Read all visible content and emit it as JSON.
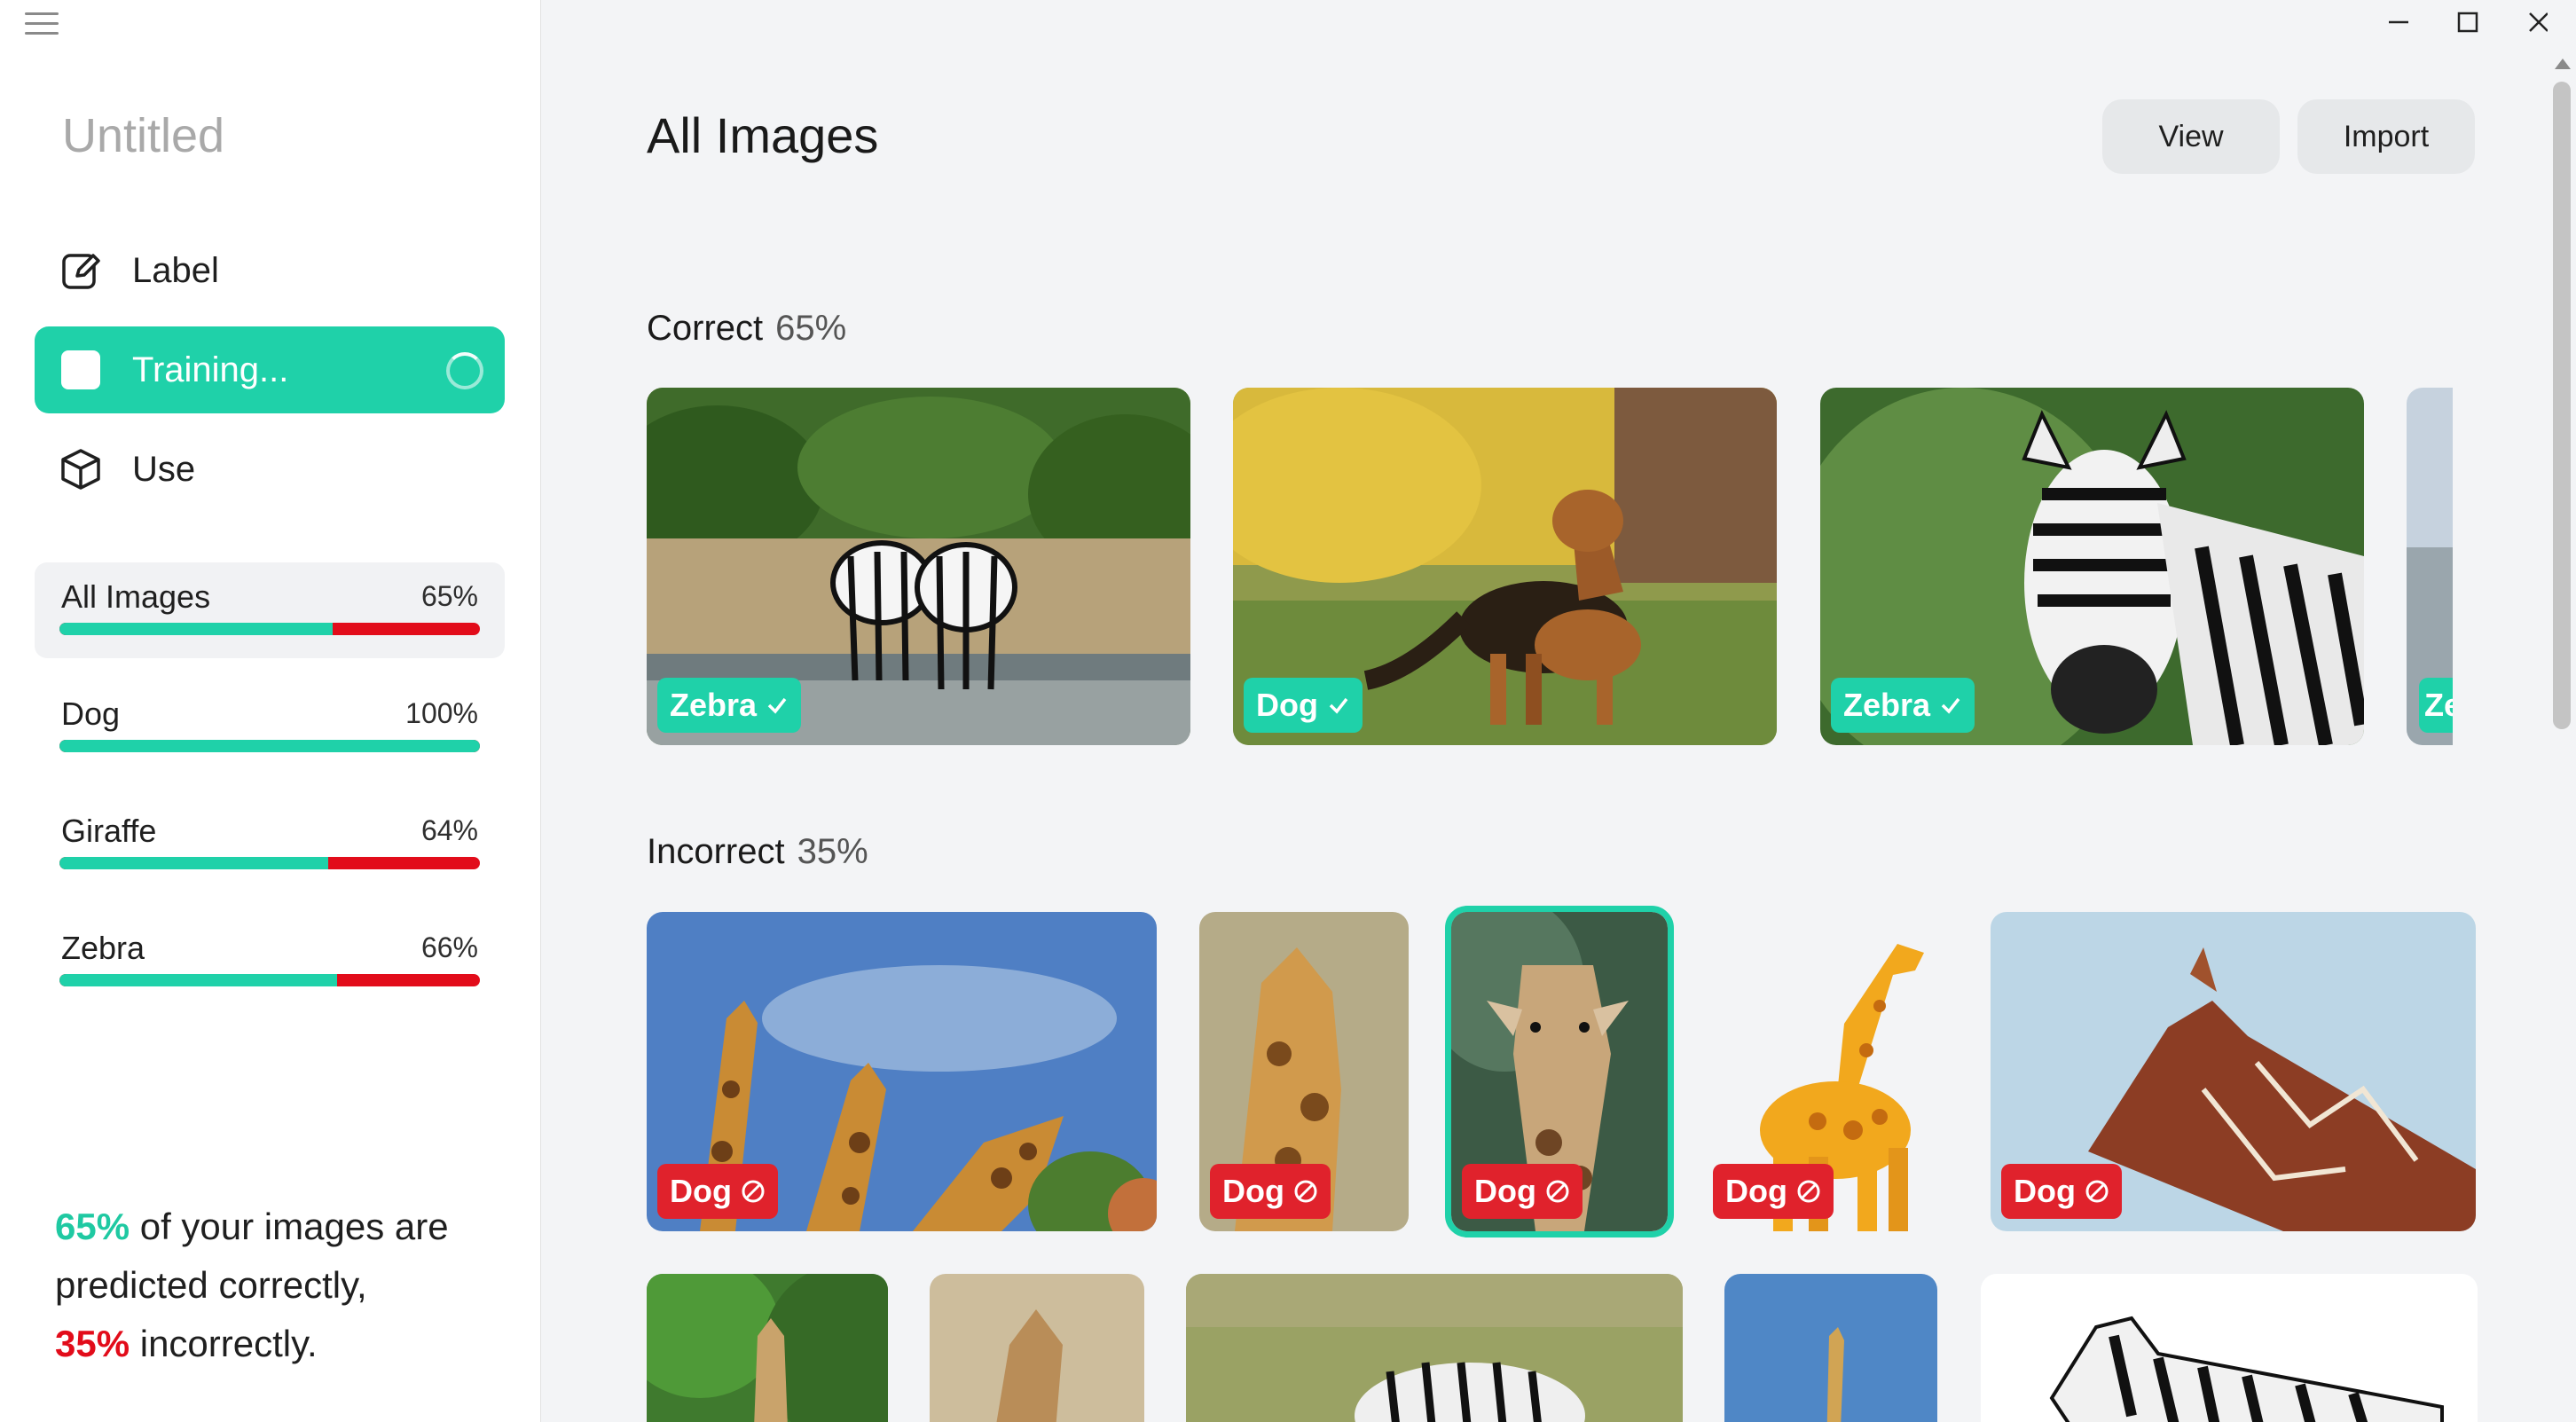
{
  "window": {
    "controls": [
      "minimize-icon",
      "maximize-icon",
      "close-icon"
    ]
  },
  "sidebar": {
    "project_title": "Untitled",
    "nav": {
      "label": "Label",
      "training": "Training...",
      "use": "Use"
    },
    "stats": [
      {
        "name": "All Images",
        "pct": "65%",
        "correct_fraction": 0.65
      },
      {
        "name": "Dog",
        "pct": "100%",
        "correct_fraction": 1.0
      },
      {
        "name": "Giraffe",
        "pct": "64%",
        "correct_fraction": 0.64
      },
      {
        "name": "Zebra",
        "pct": "66%",
        "correct_fraction": 0.66
      }
    ],
    "summary": {
      "good_pct": "65%",
      "line1_rest": " of your images are",
      "line2": "predicted correctly,",
      "bad_pct": "35%",
      "line3_rest": " incorrectly."
    }
  },
  "header": {
    "title": "All Images",
    "view_label": "View",
    "import_label": "Import"
  },
  "sections": {
    "correct": {
      "title": "Correct",
      "pct": "65%",
      "items": [
        {
          "label": "Zebra",
          "scene": "zebras-drinking"
        },
        {
          "label": "Dog",
          "scene": "german-shepherd"
        },
        {
          "label": "Zebra",
          "scene": "zebra-portrait"
        },
        {
          "label": "Ze",
          "scene": "zebra-partial"
        }
      ]
    },
    "incorrect": {
      "title": "Incorrect",
      "pct": "35%",
      "items": [
        {
          "label": "Dog",
          "scene": "giraffes-sky"
        },
        {
          "label": "Dog",
          "scene": "giraffe-closeup"
        },
        {
          "label": "Dog",
          "scene": "giraffe-selected"
        },
        {
          "label": "Dog",
          "scene": "cartoon-giraffe"
        },
        {
          "label": "Dog",
          "scene": "giraffe-head-sky"
        }
      ]
    },
    "more": [
      {
        "scene": "giraffe-trees"
      },
      {
        "scene": "giraffe-sand"
      },
      {
        "scene": "zebra-grass"
      },
      {
        "scene": "giraffe-distant"
      },
      {
        "scene": "zebra-white"
      }
    ]
  },
  "colors": {
    "accent": "#1fd1a9",
    "error": "#e20c1a",
    "sidebar_bg": "#ffffff",
    "main_bg": "#f3f4f6"
  }
}
